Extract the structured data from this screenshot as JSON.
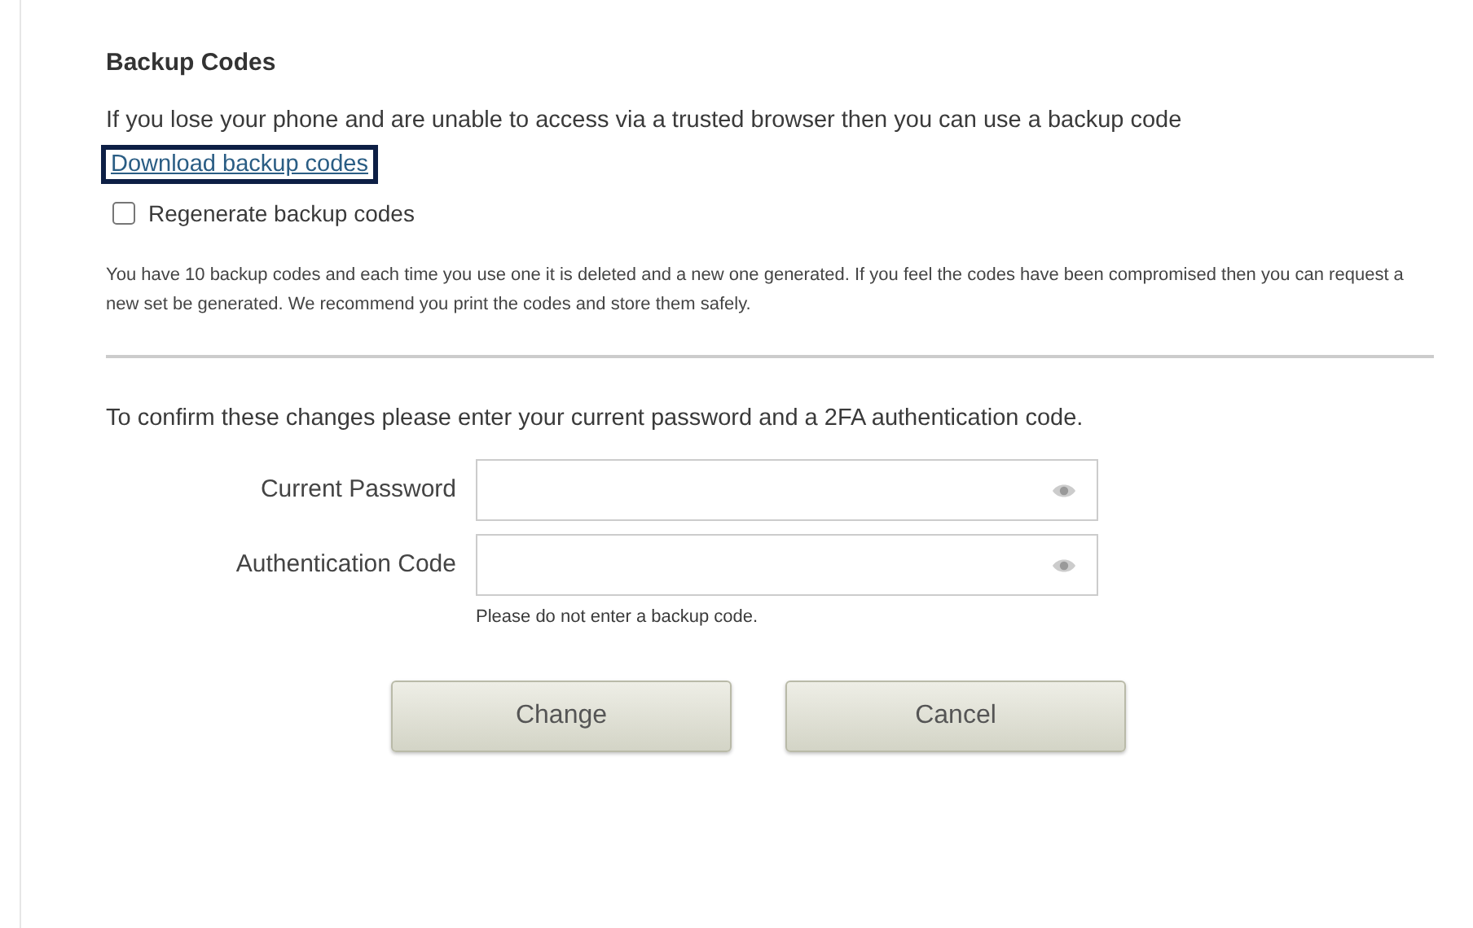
{
  "section_title": "Backup Codes",
  "intro": {
    "text": "If you lose your phone and are unable to access via a trusted browser then you can use a backup code",
    "link": {
      "label": "Download backup codes",
      "focused": true
    }
  },
  "regenerate": {
    "label": "Regenerate backup codes",
    "checked": false
  },
  "note": "You have 10 backup codes and each time you use one it is deleted and a new one generated. If you feel the codes have been compromised then you can request a new set be generated. We recommend you print the codes and store them safely.",
  "confirm_text": "To confirm these changes please enter your current password and a 2FA authentication code.",
  "fields": [
    {
      "label": "Current Password",
      "kind": "password"
    },
    {
      "label": "Authentication Code",
      "kind": "password",
      "hint": "Please do not enter a backup code."
    }
  ],
  "buttons": [
    "Change",
    "Cancel"
  ]
}
